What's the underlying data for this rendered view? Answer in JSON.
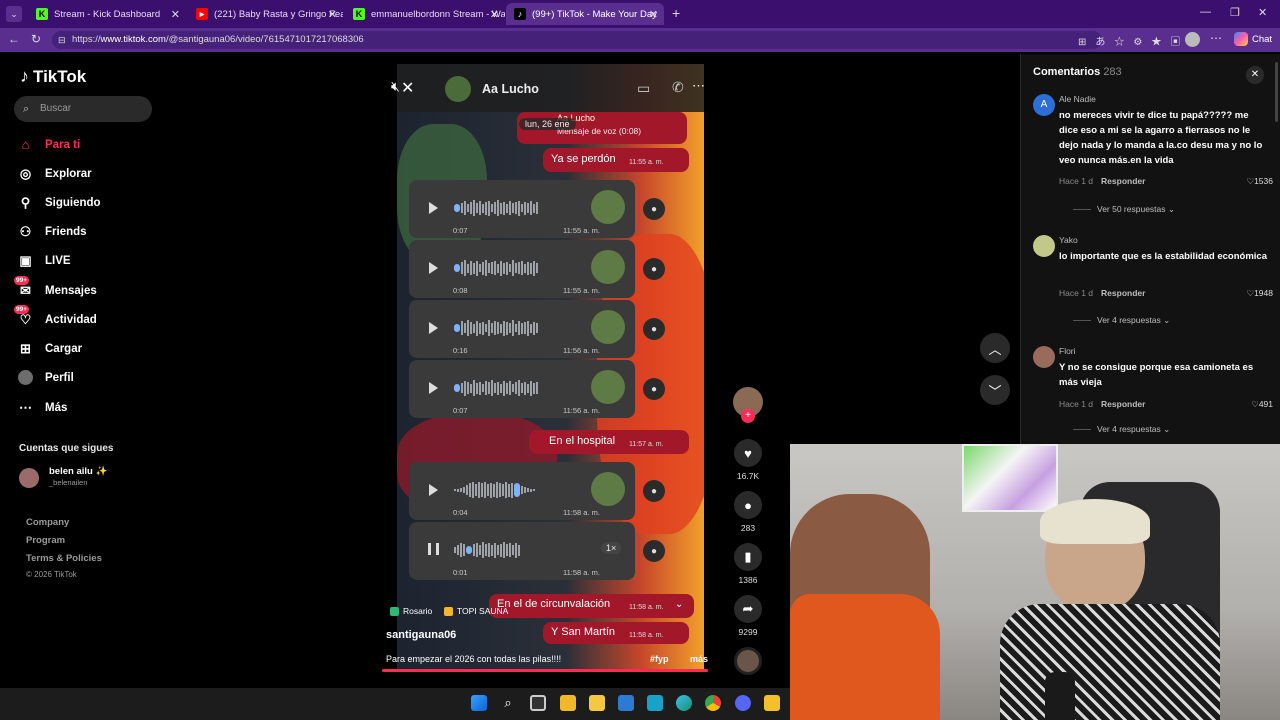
{
  "browser": {
    "tabs": [
      {
        "title": "Stream - Kick Dashboard",
        "icon": "kick-icon",
        "color": "#53fc18"
      },
      {
        "title": "(221) Baby Rasta y Gringo Feat Fa",
        "icon": "youtube-icon",
        "color": "#ff0000"
      },
      {
        "title": "emmanuelbordonn Stream - Watc",
        "icon": "kick-icon",
        "color": "#53fc18"
      },
      {
        "title": "(99+) TikTok - Make Your Day",
        "icon": "tiktok-icon",
        "color": "#000000"
      }
    ],
    "url_prefix": "https://",
    "url_host": "www.tiktok.com",
    "url_path": "/@santigauna06/video/7615471017217068306",
    "chat_label": "Chat"
  },
  "sidebar": {
    "logo": "TikTok",
    "search_placeholder": "Buscar",
    "nav": [
      {
        "label": "Para ti",
        "icon": "home-icon"
      },
      {
        "label": "Explorar",
        "icon": "compass-icon"
      },
      {
        "label": "Siguiendo",
        "icon": "following-icon"
      },
      {
        "label": "Friends",
        "icon": "friends-icon"
      },
      {
        "label": "LIVE",
        "icon": "live-icon"
      },
      {
        "label": "Mensajes",
        "icon": "messages-icon",
        "badge": "99+"
      },
      {
        "label": "Actividad",
        "icon": "activity-icon",
        "badge": "99+"
      },
      {
        "label": "Cargar",
        "icon": "upload-icon"
      },
      {
        "label": "Perfil",
        "icon": "profile-icon"
      },
      {
        "label": "Más",
        "icon": "more-icon"
      }
    ],
    "following_header": "Cuentas que sigues",
    "following": [
      {
        "name": "belen ailu ✨",
        "handle": "_belenailen"
      }
    ],
    "footer": [
      "Company",
      "Program",
      "Terms & Policies",
      "© 2026 TikTok"
    ]
  },
  "video": {
    "chat_name": "Aa Lucho",
    "quoted_name": "Aa Lucho",
    "date_chip": "lun, 26 ene",
    "quoted_text": "Mensaje de voz (0:08)",
    "msg1": "Ya se perdón",
    "msg1_time": "11:55 a. m.",
    "voice": [
      {
        "dur": "0:07",
        "time": "11:55 a. m."
      },
      {
        "dur": "0:08",
        "time": "11:55 a. m."
      },
      {
        "dur": "0:16",
        "time": "11:56 a. m."
      },
      {
        "dur": "0:07",
        "time": "11:56 a. m."
      }
    ],
    "msg2": "En el hospital",
    "msg2_time": "11:57 a. m.",
    "voice2": [
      {
        "dur": "0:04",
        "time": "11:58 a. m."
      },
      {
        "dur": "0:01",
        "time": "11:58 a. m.",
        "speed": "1×"
      }
    ],
    "msg3": "En el de circunvalación",
    "msg3_time": "11:58 a. m.",
    "msg4": "Y San Martín",
    "msg4_time": "11:58 a. m.",
    "tag1": "Rosario",
    "tag2": "TOPI SAUNA",
    "author": "santigauna06",
    "caption": "Para empezar el 2026 con todas las pilas!!!!",
    "hashtag": "#fyp",
    "more": "más"
  },
  "actions": {
    "likes": "16.7K",
    "comments": "283",
    "saves": "1386",
    "shares": "9299"
  },
  "comments": {
    "title": "Comentarios",
    "count": "283",
    "items": [
      {
        "user": "Ale Nadie",
        "text": "no mereces vivir te dice tu papá????? me dice eso a mi se la agarro a fierrasos no le dejo nada y lo manda a la.co desu ma y no lo veo nunca más.en la vida",
        "when": "Hace 1 d",
        "reply": "Responder",
        "likes": "1536",
        "replies": "Ver 50 respuestas"
      },
      {
        "user": "Yako",
        "text": "lo importante que es la estabilidad económica",
        "when": "Hace 1 d",
        "reply": "Responder",
        "likes": "1948",
        "replies": "Ver 4 respuestas"
      },
      {
        "user": "Flori",
        "text": "Y no se consigue porque esa camioneta es más vieja",
        "when": "Hace 1 d",
        "reply": "Responder",
        "likes": "491",
        "replies": "Ver 4 respuestas"
      }
    ]
  }
}
